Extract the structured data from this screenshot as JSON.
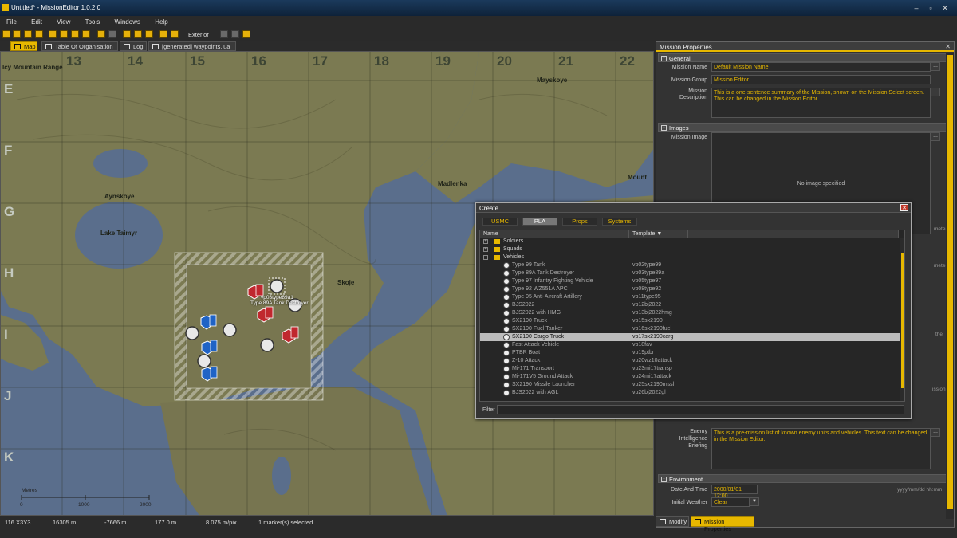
{
  "window": {
    "title": "Untitled* - MissionEditor 1.0.2.0"
  },
  "menu": [
    "File",
    "Edit",
    "View",
    "Tools",
    "Windows",
    "Help"
  ],
  "toolbar": {
    "exterior_label": "Exterior"
  },
  "tabs": [
    {
      "label": "Map",
      "icon": "map-icon"
    },
    {
      "label": "Table Of Organisation",
      "icon": "table-icon"
    },
    {
      "label": "Log",
      "icon": "log-icon"
    },
    {
      "label": "[generated] waypoints.lua",
      "icon": "script-icon"
    }
  ],
  "map": {
    "grid_columns": [
      "13",
      "14",
      "15",
      "16",
      "17",
      "18",
      "19",
      "20",
      "21",
      "22"
    ],
    "grid_rows": [
      "E",
      "F",
      "G",
      "H",
      "I",
      "J",
      "K"
    ],
    "places": [
      "Icy Mountain Range",
      "Aynskoye",
      "Lake Taimyr",
      "Madlenka",
      "Mayskoye",
      "Skoje",
      "Mount"
    ],
    "unit_label_1": "vp03type89a1",
    "unit_label_2": "Type 89A Tank Destroyer",
    "scale": {
      "title": "Metres",
      "ticks": [
        "0",
        "1000",
        "2000"
      ]
    }
  },
  "status": {
    "grid": "116 X3Y3",
    "x": "16305 m",
    "y": "-7666 m",
    "z": "177.0 m",
    "resolution": "8.075 m/pix",
    "selection": "1 marker(s) selected"
  },
  "properties": {
    "title": "Mission Properties",
    "sections": {
      "general": "General",
      "images": "Images",
      "environment": "Environment"
    },
    "mission_name_label": "Mission Name",
    "mission_name": "Default Mission Name",
    "mission_group_label": "Mission Group",
    "mission_group": "Mission Editor",
    "description_label_1": "Mission",
    "description_label_2": "Description",
    "description": "This is a one-sentence summary of the Mission, shown on the Mission Select screen. This can be changed in the Mission Editor.",
    "image_label": "Mission Image",
    "no_image": "No image specified",
    "meters_1": "meters",
    "meters_2": "meters",
    "partial_1": "the",
    "partial_2": "ission",
    "briefing_label_1": "Enemy",
    "briefing_label_2": "Intelligence",
    "briefing_label_3": "Briefing",
    "briefing": "This is a pre-mission list of known enemy units and vehicles. This text can be changed in the Mission Editor.",
    "date_label": "Date And Time",
    "date_value": "2000/01/01 12:00",
    "date_hint": "yyyy/mm/dd hh:mm",
    "weather_label": "Initial Weather",
    "weather_value": "Clear"
  },
  "bottom_tabs": [
    "Modify",
    "Mission Properties"
  ],
  "create": {
    "title": "Create",
    "factions": [
      "USMC",
      "PLA",
      "Props",
      "Systems"
    ],
    "active_faction": "PLA",
    "col_name": "Name",
    "col_template": "Template",
    "folders": [
      "Soldiers",
      "Squads",
      "Vehicles"
    ],
    "items": [
      {
        "name": "Type 99 Tank",
        "template": "vp02type99"
      },
      {
        "name": "Type 89A Tank Destroyer",
        "template": "vp03type89a"
      },
      {
        "name": "Type 97 Infantry Fighting Vehicle",
        "template": "vp05type97"
      },
      {
        "name": "Type 92 WZ551A APC",
        "template": "vp08type92"
      },
      {
        "name": "Type 95 Anti-Aircraft Artillery",
        "template": "vp11type95"
      },
      {
        "name": "BJS2022",
        "template": "vp12bj2022"
      },
      {
        "name": "BJS2022 with HMG",
        "template": "vp13bj2022hmg"
      },
      {
        "name": "SX2190 Truck",
        "template": "vp15sx2190"
      },
      {
        "name": "SX2190 Fuel Tanker",
        "template": "vp16sx2190fuel"
      },
      {
        "name": "SX2190 Cargo Truck",
        "template": "vp17sx2190carg"
      },
      {
        "name": "Fast Attack Vehicle",
        "template": "vp18fav"
      },
      {
        "name": "PTBR Boat",
        "template": "vp19ptbr"
      },
      {
        "name": "Z-10 Attack",
        "template": "vp20wz10attack"
      },
      {
        "name": "Mi-171 Transport",
        "template": "vp23mi17transp"
      },
      {
        "name": "Mi-171V5 Ground Attack",
        "template": "vp24mi17attack"
      },
      {
        "name": "SX2190 Missile Launcher",
        "template": "vp25sx2190mssl"
      },
      {
        "name": "BJS2022 with AGL",
        "template": "vp26bj2022gl"
      }
    ],
    "selected_index": 9,
    "filter_label": "Filter",
    "filter_value": ""
  },
  "colors": {
    "accent": "#e7b800",
    "terrain": "#7c7a52",
    "water": "#596d8a",
    "pla_red": "#c0282e",
    "usmc_blue": "#1f63c6"
  }
}
